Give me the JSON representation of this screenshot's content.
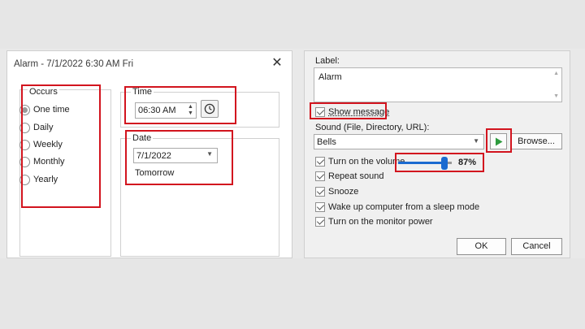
{
  "left_dialog": {
    "title": "Alarm - 7/1/2022 6:30 AM Fri",
    "close_glyph": "✕",
    "occurs": {
      "legend": "Occurs",
      "options": [
        "One time",
        "Daily",
        "Weekly",
        "Monthly",
        "Yearly"
      ],
      "selected": "One time"
    },
    "time": {
      "legend": "Time",
      "value": "06:30 AM"
    },
    "date": {
      "legend": "Date",
      "value": "7/1/2022",
      "relative": "Tomorrow"
    }
  },
  "right_dialog": {
    "label_caption": "Label:",
    "label_value": "Alarm",
    "show_message": "Show message",
    "sound_caption": "Sound (File, Directory, URL):",
    "sound_value": "Bells",
    "browse": "Browse...",
    "volume_label": "Turn on the volume",
    "volume_percent": 0.87,
    "volume_text": "87%",
    "options": [
      {
        "label": "Repeat sound",
        "checked": true
      },
      {
        "label": "Snooze",
        "checked": true
      },
      {
        "label": "Wake up computer from a sleep mode",
        "checked": true
      },
      {
        "label": "Turn on the monitor power",
        "checked": true
      }
    ],
    "ok": "OK",
    "cancel": "Cancel"
  },
  "icons": [
    "clock-icon",
    "play-icon",
    "close-icon",
    "dropdown-arrow-icon",
    "spinner-arrows-icon"
  ],
  "colors": {
    "highlight": "#d2141e",
    "slider_accent": "#1a6bd0",
    "play_green": "#2e9b3e"
  }
}
